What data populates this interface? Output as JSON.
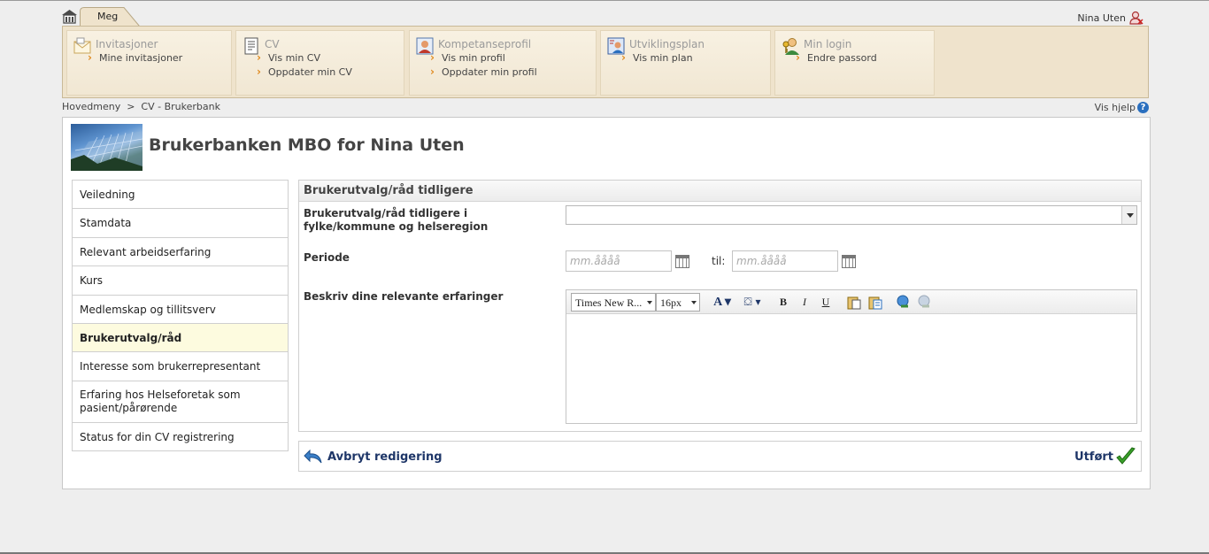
{
  "top": {
    "tab_label": "Meg",
    "user_name": "Nina Uten"
  },
  "menu": [
    {
      "title": "Invitasjoner",
      "links": [
        "Mine invitasjoner"
      ]
    },
    {
      "title": "CV",
      "links": [
        "Vis min CV",
        "Oppdater min CV"
      ]
    },
    {
      "title": "Kompetanseprofil",
      "links": [
        "Vis min profil",
        "Oppdater min profil"
      ]
    },
    {
      "title": "Utviklingsplan",
      "links": [
        "Vis min plan"
      ]
    },
    {
      "title": "Min login",
      "links": [
        "Endre passord"
      ]
    }
  ],
  "breadcrumb": "Hovedmeny  >  CV - Brukerbank",
  "help_label": "Vis hjelp",
  "help_icon": "?",
  "page_title": "Brukerbanken MBO for Nina Uten",
  "sidebar": {
    "items": [
      "Veiledning",
      "Stamdata",
      "Relevant arbeidserfaring",
      "Kurs",
      "Medlemskap og tillitsverv",
      "Brukerutvalg/råd",
      "Interesse som brukerrepresentant",
      "Erfaring hos Helseforetak som pasient/pårørende",
      "Status for din CV registrering"
    ],
    "active": "Brukerutvalg/råd"
  },
  "form": {
    "heading": "Brukerutvalg/råd tidligere",
    "field1_label": "Brukerutvalg/råd tidligere i fylke/kommune og helseregion",
    "field1_value": "",
    "periode_label": "Periode",
    "date_placeholder": "mm.åååå",
    "til_label": "til:",
    "desc_label": "Beskriv dine relevante erfaringer",
    "editor": {
      "font_family": "Times New R...",
      "font_size": "16px",
      "buttons": [
        "font-color",
        "highlight",
        "bold",
        "italic",
        "underline",
        "paste",
        "paste-text",
        "insert-link",
        "remove-link"
      ],
      "content": ""
    }
  },
  "actions": {
    "cancel_label": "Avbryt redigering",
    "done_label": "Utført"
  },
  "colors": {
    "menubar_bg": "#efe3cc",
    "accent_orange": "#e08a1e",
    "link_navy": "#1e3668",
    "active_bg": "#fdfbdf",
    "done_green": "#3aa02a"
  }
}
